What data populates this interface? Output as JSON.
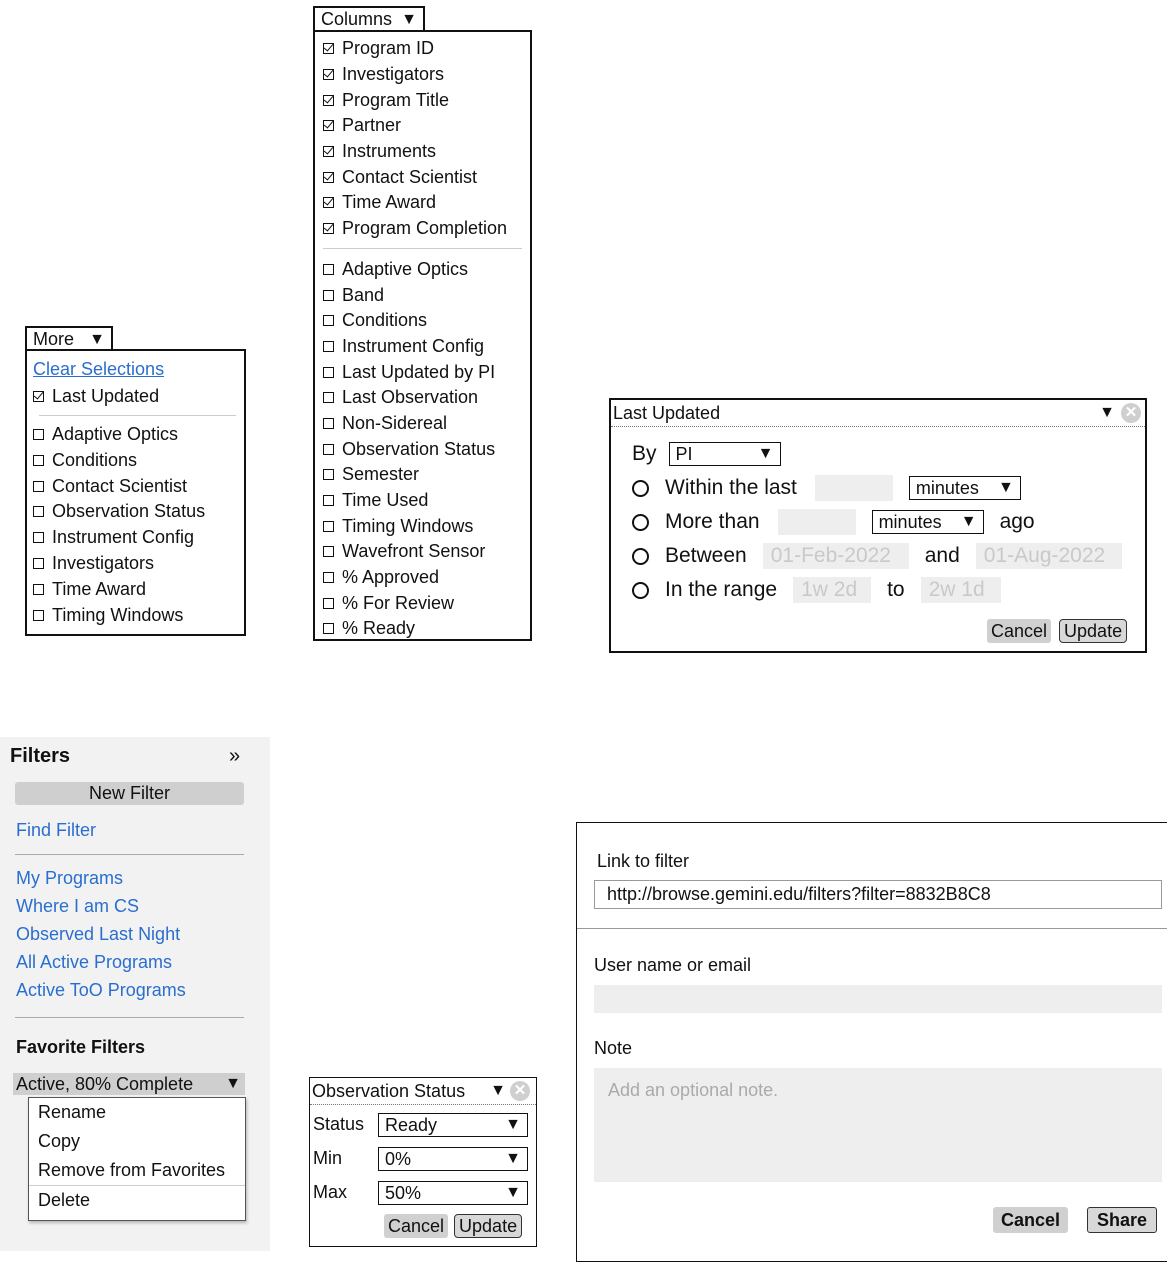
{
  "more_dropdown": {
    "button_label": "More",
    "clear_selections": "Clear Selections",
    "checked_items": [
      {
        "label": "Last Updated"
      }
    ],
    "unchecked_items": [
      {
        "label": "Adaptive Optics"
      },
      {
        "label": "Conditions"
      },
      {
        "label": "Contact Scientist"
      },
      {
        "label": "Observation Status"
      },
      {
        "label": "Instrument Config"
      },
      {
        "label": "Investigators"
      },
      {
        "label": "Time Award"
      },
      {
        "label": "Timing Windows"
      }
    ]
  },
  "columns_dropdown": {
    "button_label": "Columns",
    "checked_items": [
      {
        "label": "Program ID"
      },
      {
        "label": "Investigators"
      },
      {
        "label": "Program Title"
      },
      {
        "label": "Partner"
      },
      {
        "label": "Instruments"
      },
      {
        "label": "Contact Scientist"
      },
      {
        "label": "Time Award"
      },
      {
        "label": "Program Completion"
      }
    ],
    "unchecked_items": [
      {
        "label": "Adaptive Optics"
      },
      {
        "label": "Band"
      },
      {
        "label": "Conditions"
      },
      {
        "label": "Instrument Config"
      },
      {
        "label": "Last Updated by PI"
      },
      {
        "label": "Last Observation"
      },
      {
        "label": "Non-Sidereal"
      },
      {
        "label": "Observation Status"
      },
      {
        "label": "Semester"
      },
      {
        "label": "Time Used"
      },
      {
        "label": "Timing Windows"
      },
      {
        "label": "Wavefront Sensor"
      },
      {
        "label": "% Approved"
      },
      {
        "label": "% For Review"
      },
      {
        "label": "% Ready"
      }
    ]
  },
  "last_updated": {
    "title": "Last Updated",
    "by_label": "By",
    "by_value": "PI",
    "within_label": "Within the last",
    "within_unit": "minutes",
    "more_than_label": "More than",
    "more_than_unit": "minutes",
    "ago_label": "ago",
    "between_label": "Between",
    "between_from": "01-Feb-2022",
    "and_label": "and",
    "between_to": "01-Aug-2022",
    "range_label": "In the range",
    "range_from": "1w 2d",
    "to_label": "to",
    "range_to": "2w 1d",
    "cancel": "Cancel",
    "update": "Update"
  },
  "filters_panel": {
    "title": "Filters",
    "collapse_glyph": "»",
    "new_filter": "New Filter",
    "find_filter": "Find Filter",
    "links": [
      {
        "label": "My Programs"
      },
      {
        "label": "Where I am CS"
      },
      {
        "label": "Observed Last Night"
      },
      {
        "label": "All Active Programs"
      },
      {
        "label": "Active ToO Programs"
      }
    ],
    "favorites_heading": "Favorite Filters",
    "favorite_selected": "Active, 80% Complete",
    "menu_items": [
      {
        "label": "Rename"
      },
      {
        "label": "Copy"
      },
      {
        "label": "Remove from Favorites"
      },
      {
        "label": "Delete"
      }
    ]
  },
  "observation_status": {
    "title": "Observation Status",
    "status_label": "Status",
    "status_value": "Ready",
    "min_label": "Min",
    "min_value": "0%",
    "max_label": "Max",
    "max_value": "50%",
    "cancel": "Cancel",
    "update": "Update"
  },
  "share_dialog": {
    "link_label": "Link to filter",
    "link_value": "http://browse.gemini.edu/filters?filter=8832B8C8",
    "user_label": "User name or email",
    "user_value": "",
    "note_label": "Note",
    "note_placeholder": "Add an optional note.",
    "cancel": "Cancel",
    "share": "Share"
  },
  "colors": {
    "link": "#2a6ecf",
    "panel_bg": "#f2f2f2",
    "input_bg": "#eeeeee",
    "button_bg": "#d0d0d0"
  }
}
